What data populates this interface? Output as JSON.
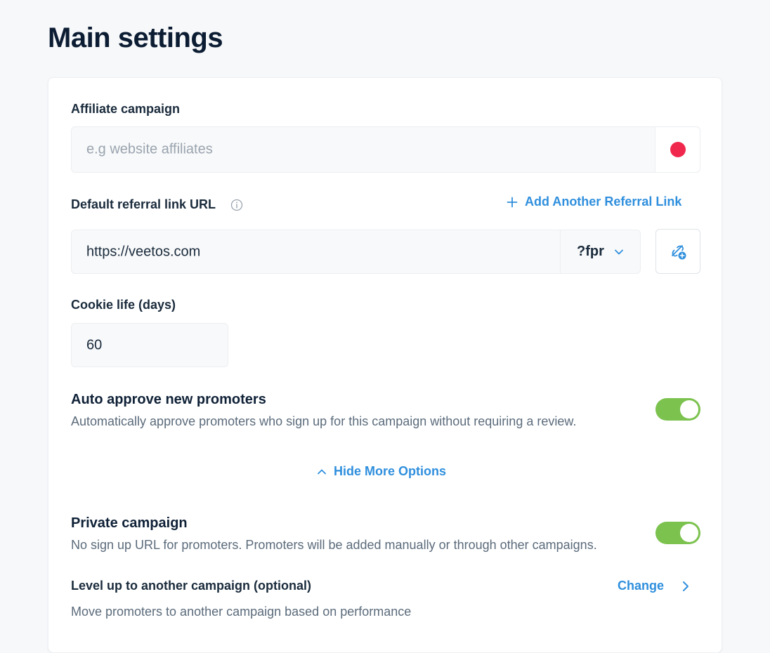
{
  "page": {
    "title": "Main settings"
  },
  "colors": {
    "accent": "#2f8fdd",
    "campaign_color": "#f0284d",
    "toggle_on": "#7cc24f"
  },
  "affiliate_campaign": {
    "label": "Affiliate campaign",
    "value": "",
    "placeholder": "e.g website affiliates"
  },
  "referral_link": {
    "label": "Default referral link URL",
    "info_icon": "info-circle-icon",
    "add_label": "Add Another Referral Link",
    "value": "https://veetos.com",
    "param": "?fpr",
    "edit_icon": "link-settings-icon"
  },
  "cookie_life": {
    "label": "Cookie life (days)",
    "value": "60"
  },
  "auto_approve": {
    "title": "Auto approve new promoters",
    "description": "Automatically approve promoters who sign up for this campaign without requiring a review.",
    "enabled": true
  },
  "more_options": {
    "label": "Hide More Options"
  },
  "private_campaign": {
    "title": "Private campaign",
    "description": "No sign up URL for promoters. Promoters will be added manually or through other campaigns.",
    "enabled": true
  },
  "level_up": {
    "title": "Level up to another campaign (optional)",
    "change_label": "Change",
    "description": "Move promoters to another campaign based on performance"
  }
}
